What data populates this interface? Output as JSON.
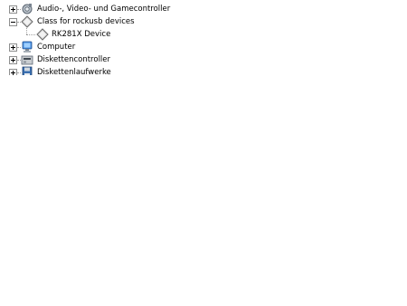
{
  "device_tree": {
    "items": [
      {
        "label": "Audio-, Video- und Gamecontroller",
        "icon": "audio-controller-icon",
        "expander": "plus"
      },
      {
        "label": "Class for rockusb devices",
        "icon": "device-class-icon",
        "expander": "minus"
      },
      {
        "label": "RK281X Device",
        "icon": "device-icon"
      },
      {
        "label": "Computer",
        "icon": "computer-icon",
        "expander": "plus"
      },
      {
        "label": "Diskettencontroller",
        "icon": "floppy-controller-icon",
        "expander": "plus"
      },
      {
        "label": "Diskettenlaufwerke",
        "icon": "floppy-drive-icon",
        "expander": "plus"
      }
    ]
  }
}
